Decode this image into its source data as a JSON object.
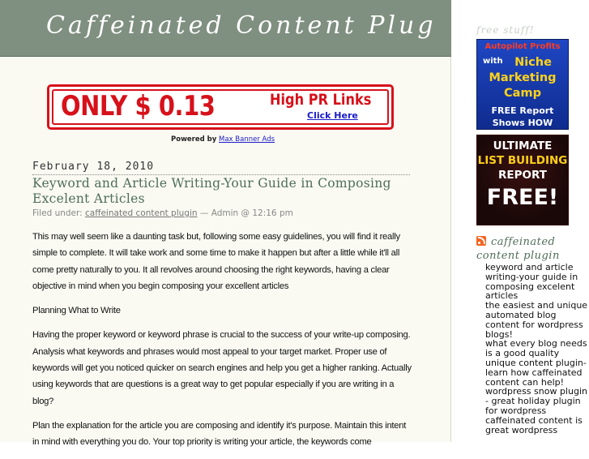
{
  "header": {
    "title": "Caffeinated Content Plug"
  },
  "banner": {
    "main": "ONLY $ 0.13",
    "sub": "High PR Links",
    "cta": "Click Here",
    "powered_prefix": "Powered by",
    "powered_link": "Max Banner Ads"
  },
  "post": {
    "date": "February 18, 2010",
    "title": "Keyword and Article Writing-Your Guide in Composing Excelent Articles",
    "meta_prefix": "Filed under:",
    "meta_category": "caffeinated content plugin",
    "meta_suffix": "— Admin @ 12:16 pm",
    "paragraphs": [
      "This may well seem like a daunting task but, following some easy guidelines, you will find it really simple to complete. It will take work and some time to make it happen but after a little while it'll all come pretty naturally to you. It all revolves around choosing the right keywords, having a clear objective in mind when you begin composing your excellent articles",
      "Planning What to Write",
      "Having the proper keyword or keyword phrase is crucial to the success of your write-up composing. Analysis what keywords and phrases would most appeal to your target market. Proper use of keywords will get you noticed quicker on search engines and help you get a higher ranking. Actually using keywords that are questions is a great way to get popular especially if you are writing in a blog?",
      "Plan the explanation for the article you are composing and identify it's purpose. Maintain this intent in mind with everything you do. Your top priority is writing your article, the keywords come"
    ]
  },
  "sidebar": {
    "heading": "free stuff!",
    "ad1": {
      "line1": "Autopilot Profits",
      "with": "with",
      "niche": "Niche",
      "marketing": "Marketing",
      "camp": "Camp",
      "free_report": "FREE Report",
      "shows_how": "Shows HOW"
    },
    "ad2": {
      "line1": "ULTIMATE",
      "line2": "LIST BUILDING",
      "line3": "REPORT",
      "line4": "FREE!"
    },
    "feed_title": "caffeinated content plugin",
    "feed_items": [
      "keyword and article writing-your guide in composing excelent articles",
      "the easiest and unique automated blog content for wordpress blogs!",
      "what every blog needs is a good quality unique content plugin- learn how caffeinated content can help!",
      "wordpress snow plugin - great holiday plugin for wordpress",
      "caffeinated content is great wordpress"
    ]
  },
  "colors": {
    "header_bg": "#7f8f80",
    "title_link": "#4f6e58",
    "banner_red": "#d7111a"
  }
}
